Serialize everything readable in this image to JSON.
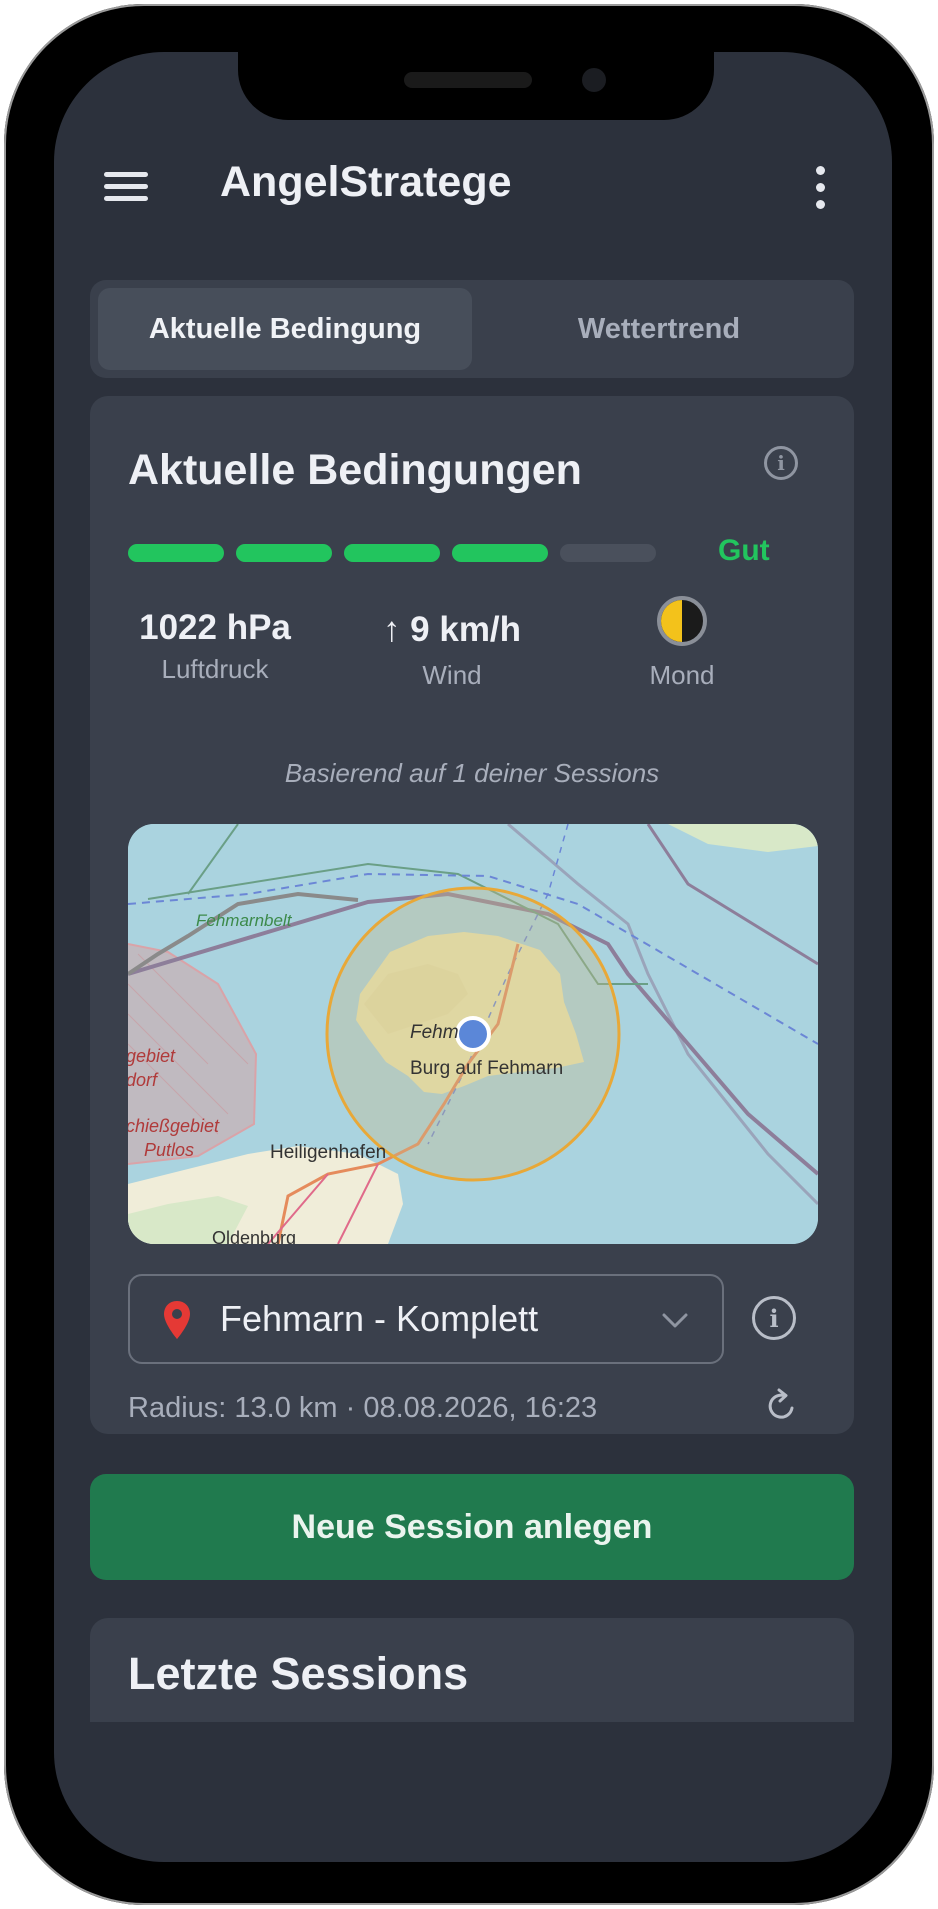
{
  "app": {
    "title": "AngelStratege"
  },
  "tabs": [
    {
      "label": "Aktuelle Bedingung",
      "active": true
    },
    {
      "label": "Wettertrend",
      "active": false
    }
  ],
  "conditions": {
    "title": "Aktuelle Bedingungen",
    "rating": {
      "label": "Gut",
      "filled_segments": 4,
      "total_segments": 5,
      "color": "#22c55e"
    },
    "pressure": {
      "value": "1022 hPa",
      "label": "Luftdruck"
    },
    "wind": {
      "value": "↑ 9 km/h",
      "label": "Wind"
    },
    "moon": {
      "label": "Mond",
      "icon": "moon-half-icon"
    },
    "based_on": "Basierend auf 1 deiner Sessions"
  },
  "map": {
    "labels": {
      "fehmarnbelt": "Fehmarnbelt",
      "fehmarn": "Fehm",
      "burg": "Burg auf Fehmarn",
      "heiligenhafen": "Heiligenhafen",
      "oldenburg": "Oldenburg",
      "restricted1": "gebiet",
      "restricted2": "dorf",
      "restricted3": "chießgebiet",
      "restricted4": "Putlos"
    }
  },
  "location": {
    "selected": "Fehmarn - Komplett",
    "meta": "Radius: 13.0 km  ·  08.08.2026, 16:23"
  },
  "actions": {
    "new_session": "Neue Session anlegen"
  },
  "last_sessions": {
    "title": "Letzte Sessions"
  },
  "colors": {
    "background": "#2c313c",
    "card": "#3a404c",
    "accent_green": "#22c55e",
    "button_green": "#207a4e",
    "pin_red": "#e53935"
  }
}
